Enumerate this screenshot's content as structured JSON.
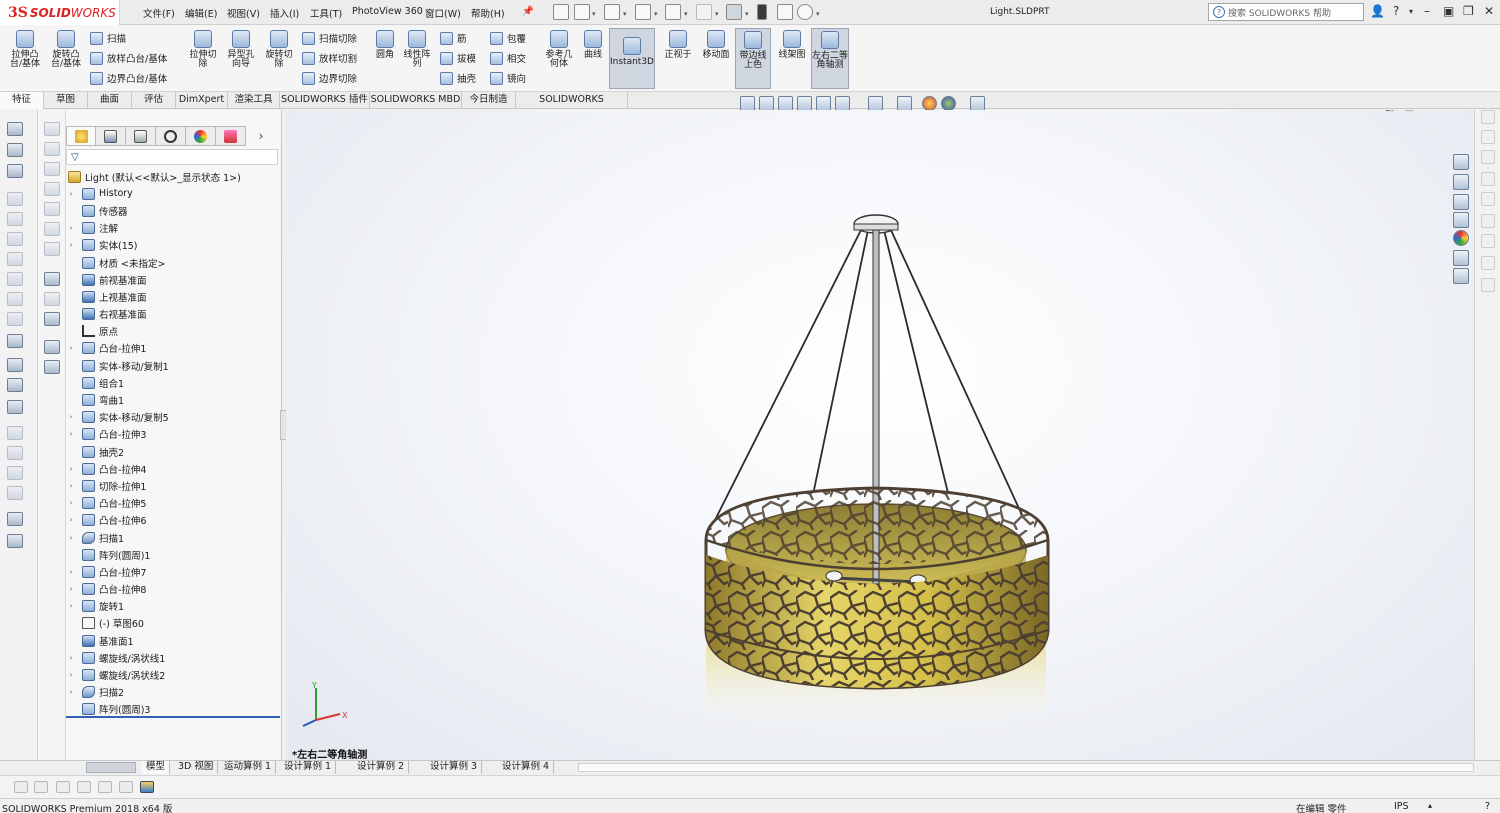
{
  "app": {
    "logo_ds": "3S",
    "logo_solid": "SOLID",
    "logo_works": "WORKS",
    "document_title": "Light.SLDPRT"
  },
  "menu": [
    "文件(F)",
    "编辑(E)",
    "视图(V)",
    "插入(I)",
    "工具(T)",
    "PhotoView 360",
    "窗口(W)",
    "帮助(H)"
  ],
  "search": {
    "placeholder": "搜索 SOLIDWORKS 帮助"
  },
  "ribbon": {
    "extrude_boss": "拉伸凸台/基体",
    "revolve_boss": "旋转凸台/基体",
    "sweep": "扫描",
    "loft_boss": "放样凸台/基体",
    "boundary_boss": "边界凸台/基体",
    "extrude_cut": "拉伸切除",
    "hole_wizard": "异型孔向导",
    "revolve_cut": "旋转切除",
    "swept_cut": "扫描切除",
    "lofted_cut": "放样切割",
    "boundary_cut": "边界切除",
    "fillet": "圆角",
    "linear_pattern": "线性阵列",
    "rib": "筋",
    "draft": "拔模",
    "shell": "抽壳",
    "wrap": "包覆",
    "intersect": "相交",
    "mirror": "镜向",
    "ref_geometry": "参考几何体",
    "curves": "曲线",
    "instant3d": "Instant3D",
    "normal_to": "正视于",
    "move_face": "移动面",
    "shaded_edges": "带边线上色",
    "wireframe": "线架图",
    "isometric": "左右二等角轴测"
  },
  "cm_tabs": [
    "特征",
    "草图",
    "曲面",
    "评估",
    "DimXpert",
    "渲染工具",
    "SOLIDWORKS 插件",
    "SOLIDWORKS MBD",
    "今日制造",
    "SOLIDWORKS Inspection"
  ],
  "tree": [
    {
      "label": "Light  (默认<<默认>_显示状态 1>)",
      "arrow": "",
      "icon": "root"
    },
    {
      "label": "History",
      "arrow": "›",
      "icon": "folder"
    },
    {
      "label": "传感器",
      "arrow": "",
      "icon": "folder"
    },
    {
      "label": "注解",
      "arrow": "›",
      "icon": "folder"
    },
    {
      "label": "实体(15)",
      "arrow": "›",
      "icon": "folder"
    },
    {
      "label": "材质 <未指定>",
      "arrow": "",
      "icon": "material"
    },
    {
      "label": "前视基准面",
      "arrow": "",
      "icon": "plane"
    },
    {
      "label": "上视基准面",
      "arrow": "",
      "icon": "plane"
    },
    {
      "label": "右视基准面",
      "arrow": "",
      "icon": "plane"
    },
    {
      "label": "原点",
      "arrow": "",
      "icon": "origin"
    },
    {
      "label": "凸台-拉伸1",
      "arrow": "›",
      "icon": "feature"
    },
    {
      "label": "实体-移动/复制1",
      "arrow": "",
      "icon": "feature"
    },
    {
      "label": "组合1",
      "arrow": "",
      "icon": "feature"
    },
    {
      "label": "弯曲1",
      "arrow": "",
      "icon": "feature"
    },
    {
      "label": "实体-移动/复制5",
      "arrow": "›",
      "icon": "feature"
    },
    {
      "label": "凸台-拉伸3",
      "arrow": "›",
      "icon": "feature"
    },
    {
      "label": "抽壳2",
      "arrow": "",
      "icon": "feature"
    },
    {
      "label": "凸台-拉伸4",
      "arrow": "›",
      "icon": "feature"
    },
    {
      "label": "切除-拉伸1",
      "arrow": "›",
      "icon": "feature"
    },
    {
      "label": "凸台-拉伸5",
      "arrow": "›",
      "icon": "feature"
    },
    {
      "label": "凸台-拉伸6",
      "arrow": "›",
      "icon": "feature"
    },
    {
      "label": "扫描1",
      "arrow": "›",
      "icon": "sweep"
    },
    {
      "label": "阵列(圆周)1",
      "arrow": "",
      "icon": "feature"
    },
    {
      "label": "凸台-拉伸7",
      "arrow": "›",
      "icon": "feature"
    },
    {
      "label": "凸台-拉伸8",
      "arrow": "›",
      "icon": "feature"
    },
    {
      "label": "旋转1",
      "arrow": "›",
      "icon": "feature"
    },
    {
      "label": "(-) 草图60",
      "arrow": "",
      "icon": "sketch"
    },
    {
      "label": "基准面1",
      "arrow": "",
      "icon": "plane"
    },
    {
      "label": "螺旋线/涡状线1",
      "arrow": "›",
      "icon": "feature"
    },
    {
      "label": "螺旋线/涡状线2",
      "arrow": "›",
      "icon": "feature"
    },
    {
      "label": "扫描2",
      "arrow": "›",
      "icon": "sweep"
    },
    {
      "label": "阵列(圆周)3",
      "arrow": "",
      "icon": "feature"
    }
  ],
  "viewport": {
    "view_label": "*左右二等角轴测"
  },
  "bottom_tabs": [
    "模型",
    "3D 视图",
    "运动算例 1",
    "设计算例 1",
    "设计算例 2",
    "设计算例 3",
    "设计算例 4"
  ],
  "status": {
    "product": "SOLIDWORKS Premium 2018 x64 版",
    "mode": "在编辑 零件",
    "units": "IPS"
  },
  "colors": {
    "brand_red": "#d22222",
    "tree_selection_bar": "#2f62b5",
    "shade_gold": "#d9c250",
    "cage_bronze": "#5a4a38"
  }
}
